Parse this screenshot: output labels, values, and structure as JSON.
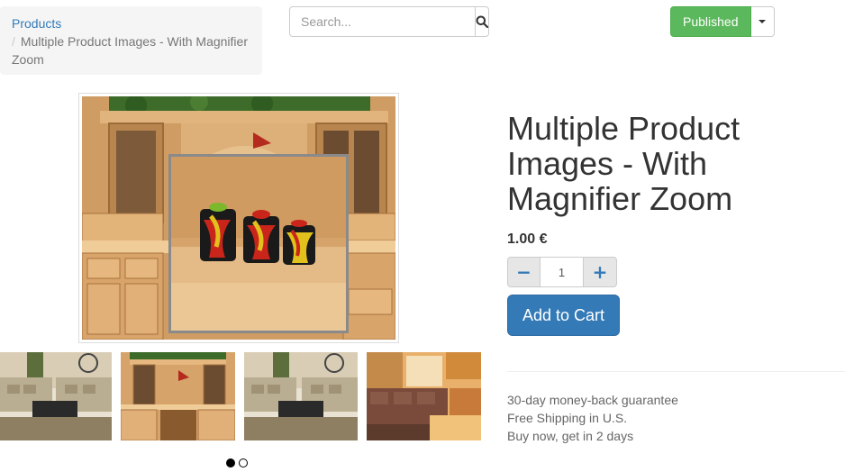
{
  "breadcrumb": {
    "parent": "Products",
    "separator": "/",
    "current": "Multiple Product Images - With Magnifier Zoom"
  },
  "search": {
    "placeholder": "Search...",
    "icon": "search-icon"
  },
  "publish": {
    "label": "Published",
    "color": "#5cb85c"
  },
  "product": {
    "title": "Multiple Product Images - With Magnifier Zoom",
    "price": "1.00 €",
    "quantity": "1",
    "add_to_cart_label": "Add to Cart",
    "minus_symbol": "−",
    "plus_symbol": "+",
    "guarantees": [
      "30-day money-back guarantee",
      "Free Shipping in U.S.",
      "Buy now, get in 2 days"
    ]
  },
  "gallery": {
    "thumbnails": [
      {
        "subject": "living room with sofas"
      },
      {
        "subject": "wooden kitchen hutch"
      },
      {
        "subject": "living room with sofas"
      },
      {
        "subject": "living room with sectional sofa"
      }
    ],
    "carousel_pages": 2,
    "active_page": 1
  },
  "colors": {
    "primary": "#337ab7",
    "link": "#337ab7",
    "muted": "#777777"
  }
}
